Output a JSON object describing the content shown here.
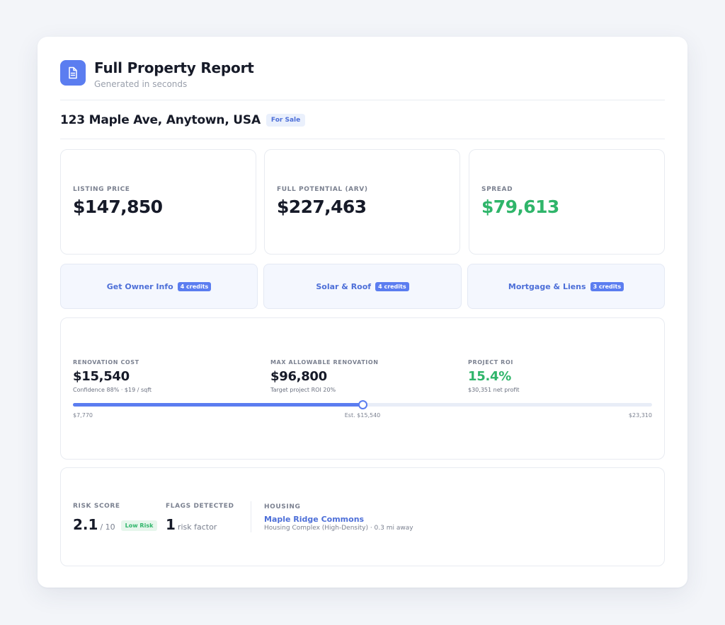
{
  "header": {
    "icon": "document-icon",
    "title": "Full Property Report",
    "subtitle": "Generated in seconds"
  },
  "property": {
    "address": "123 Maple Ave, Anytown, USA",
    "status_badge": "For Sale"
  },
  "metrics": [
    {
      "label": "LISTING PRICE",
      "value": "$147,850"
    },
    {
      "label": "FULL POTENTIAL (ARV)",
      "value": "$227,463"
    },
    {
      "label": "SPREAD",
      "value": "$79,613"
    }
  ],
  "actions": [
    {
      "label": "Get Owner Info",
      "credits": "4 credits"
    },
    {
      "label": "Solar & Roof",
      "credits": "4 credits"
    },
    {
      "label": "Mortgage & Liens",
      "credits": "3 credits"
    }
  ],
  "renovation": {
    "cost_label": "RENOVATION COST",
    "cost_value": "$15,540",
    "cost_sub": "Confidence 88% · $19 / sqft",
    "max_label": "MAX ALLOWABLE RENOVATION",
    "max_value": "$96,800",
    "max_sub": "Target project ROI 20%",
    "roi_label": "PROJECT ROI",
    "roi_value": "15.4%",
    "roi_sub": "$30,351 net profit",
    "range": {
      "min": 7770,
      "max": 23310,
      "estimate": 15540,
      "min_label": "$7,770",
      "est_label": "Est. $15,540",
      "max_label": "$23,310"
    }
  },
  "risk": {
    "score_label": "RISK SCORE",
    "score_value": "2.1",
    "score_scale": "/ 10",
    "score_badge": "Low Risk",
    "flags_label": "FLAGS DETECTED",
    "flags_value": "1",
    "flags_unit": "risk factor",
    "housing_label": "HOUSING",
    "housing_name": "Maple Ridge Commons",
    "housing_detail": "Housing Complex (High-Density) · 0.3 mi away"
  },
  "colors": {
    "accent": "#5b7df0",
    "link": "#4d6fd8",
    "positive": "#2fb56a",
    "text": "#161a28",
    "muted": "#7b8190"
  }
}
